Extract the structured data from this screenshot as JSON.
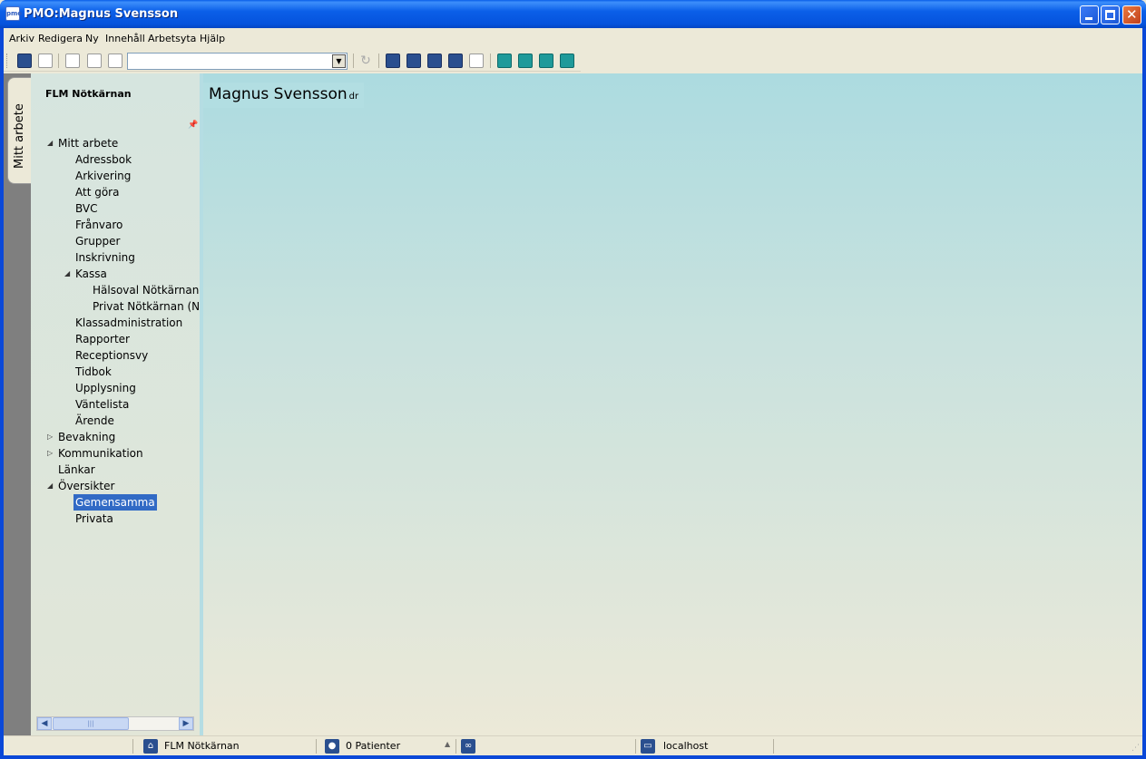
{
  "window": {
    "icon_text": "pmo",
    "title": "PMO:Magnus Svensson"
  },
  "menubar": {
    "items": [
      "Arkiv",
      "Redigera",
      "Ny",
      "Innehåll",
      "Arbetsyta",
      "Hjälp"
    ]
  },
  "toolbar": {
    "combo_value": "",
    "icons": [
      "search-icon",
      "close-doc-icon",
      "print-icon",
      "copy-icon",
      "page-icon",
      "refresh-icon",
      "maximize-layout-icon",
      "center-layout-icon",
      "split-vertical-icon",
      "split-horizontal-icon",
      "single-view-icon",
      "mail-icon",
      "asterisk-icon",
      "users-icon",
      "schedule-icon"
    ]
  },
  "side_tab": {
    "label": "Mitt arbete"
  },
  "nav": {
    "title": "FLM Nötkärnan",
    "tree": [
      {
        "label": "Mitt arbete",
        "level": 0,
        "expander": "expanded"
      },
      {
        "label": "Adressbok",
        "level": 1
      },
      {
        "label": "Arkivering",
        "level": 1
      },
      {
        "label": "Att göra",
        "level": 1
      },
      {
        "label": "BVC",
        "level": 1
      },
      {
        "label": "Frånvaro",
        "level": 1
      },
      {
        "label": "Grupper",
        "level": 1
      },
      {
        "label": "Inskrivning",
        "level": 1
      },
      {
        "label": "Kassa",
        "level": 1,
        "expander": "expanded"
      },
      {
        "label": "Hälsoval Nötkärnan",
        "level": 2
      },
      {
        "label": "Privat Nötkärnan (N",
        "level": 2
      },
      {
        "label": "Klassadministration",
        "level": 1
      },
      {
        "label": "Rapporter",
        "level": 1
      },
      {
        "label": "Receptionsvy",
        "level": 1
      },
      {
        "label": "Tidbok",
        "level": 1
      },
      {
        "label": "Upplysning",
        "level": 1
      },
      {
        "label": "Väntelista",
        "level": 1
      },
      {
        "label": "Ärende",
        "level": 1
      },
      {
        "label": "Bevakning",
        "level": 0,
        "expander": "collapsed"
      },
      {
        "label": "Kommunikation",
        "level": 0,
        "expander": "collapsed"
      },
      {
        "label": "Länkar",
        "level": 0
      },
      {
        "label": "Översikter",
        "level": 0,
        "expander": "expanded"
      },
      {
        "label": "Gemensamma",
        "level": 1,
        "selected": true
      },
      {
        "label": "Privata",
        "level": 1
      }
    ]
  },
  "content": {
    "tab_title": "Magnus Svensson",
    "tab_sub": "dr"
  },
  "statusbar": {
    "unit": "FLM Nötkärnan",
    "patients": "0 Patienter",
    "host": "localhost"
  },
  "colors": {
    "titlebar": "#0a5ee8",
    "selection": "#316ac5",
    "content_bg": "#acdbe0"
  }
}
